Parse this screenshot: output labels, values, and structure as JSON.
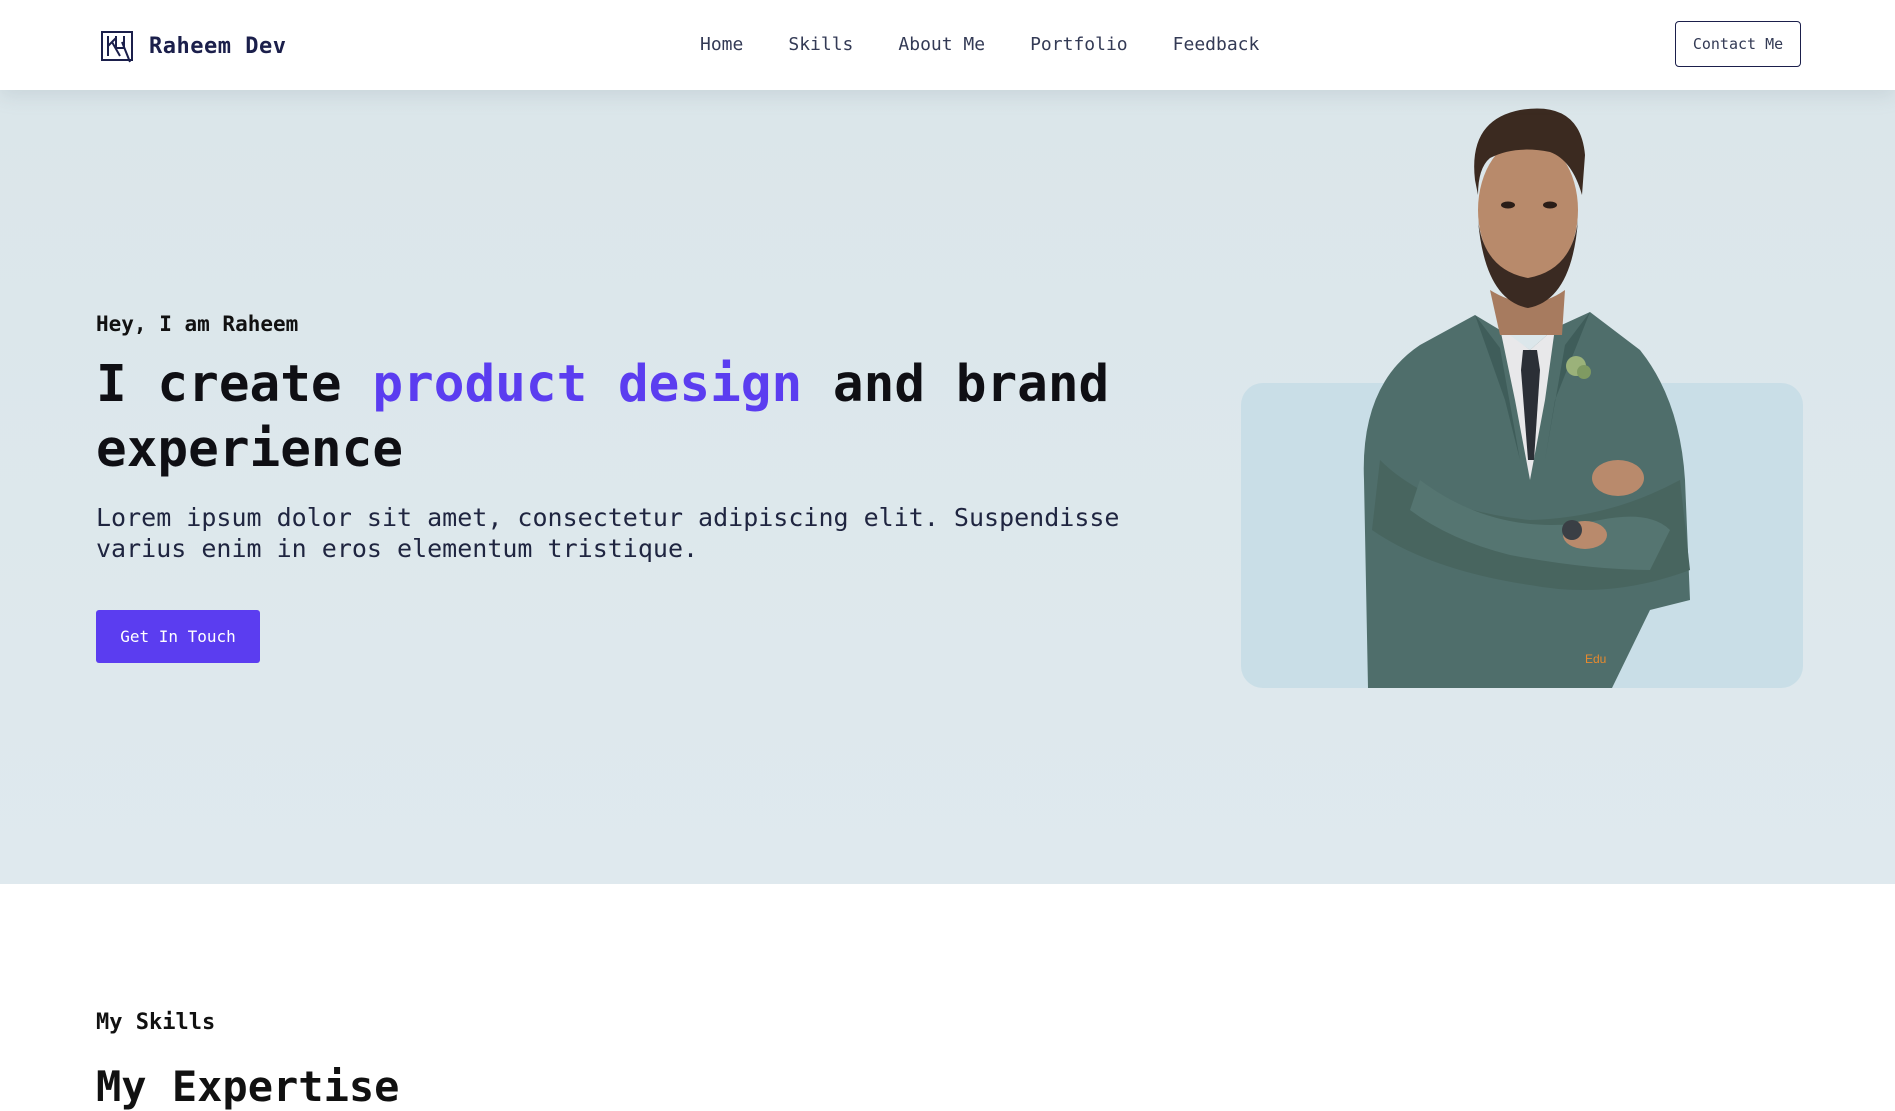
{
  "brand": {
    "name": "Raheem Dev",
    "logo_icon": "rh-monogram-icon"
  },
  "nav": {
    "items": [
      {
        "label": "Home"
      },
      {
        "label": "Skills"
      },
      {
        "label": "About Me"
      },
      {
        "label": "Portfolio"
      },
      {
        "label": "Feedback"
      }
    ]
  },
  "header": {
    "contact_label": "Contact Me"
  },
  "scroll_indicator": {
    "progress": 0.2
  },
  "hero": {
    "greeting": "Hey, I am Raheem",
    "headline_pre": "I create ",
    "headline_accent": "product design",
    "headline_post": " and brand experience",
    "description": "Lorem ipsum dolor sit amet, consectetur adipiscing elit. Suspendisse varius enim in eros elementum tristique.",
    "cta_label": "Get In Touch",
    "watermark": "Edu"
  },
  "skills": {
    "kicker": "My Skills",
    "title": "My Expertise"
  },
  "colors": {
    "accent": "#5b3df0",
    "hero_bg": "#dde8ed",
    "card_bg": "#c9dee7",
    "brand_text": "#1b1f4b"
  }
}
